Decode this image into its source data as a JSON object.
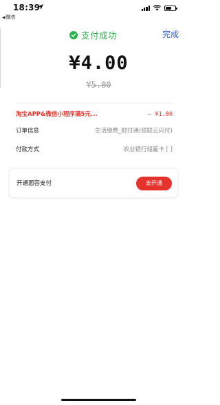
{
  "status_bar": {
    "time": "18:39",
    "back_app_label": "微信",
    "back_arrow": "◀",
    "battery_level": 0.6
  },
  "header": {
    "title": "支付成功",
    "done_label": "完成",
    "accent_color": "#2bb44a",
    "link_color": "#2f64c8"
  },
  "payment": {
    "amount": "¥4.00",
    "original_amount": "¥5.00"
  },
  "details": {
    "discount_label": "淘宝APP&微信小程序满5元...",
    "discount_value": "– ¥1.00",
    "order_label": "订单信息",
    "order_value": "生活缴费_财付通(银联云闪付)",
    "payment_method_label": "付款方式",
    "payment_method_value": "农业银行储蓄卡 [     ]"
  },
  "face_pay": {
    "label": "开通面容支付",
    "button_label": "去开通",
    "button_color": "#e5322d"
  },
  "icons": {
    "location": "location-arrow-icon",
    "signal": "signal-icon",
    "wifi": "wifi-icon",
    "battery": "battery-icon",
    "success": "check-circle-icon"
  }
}
